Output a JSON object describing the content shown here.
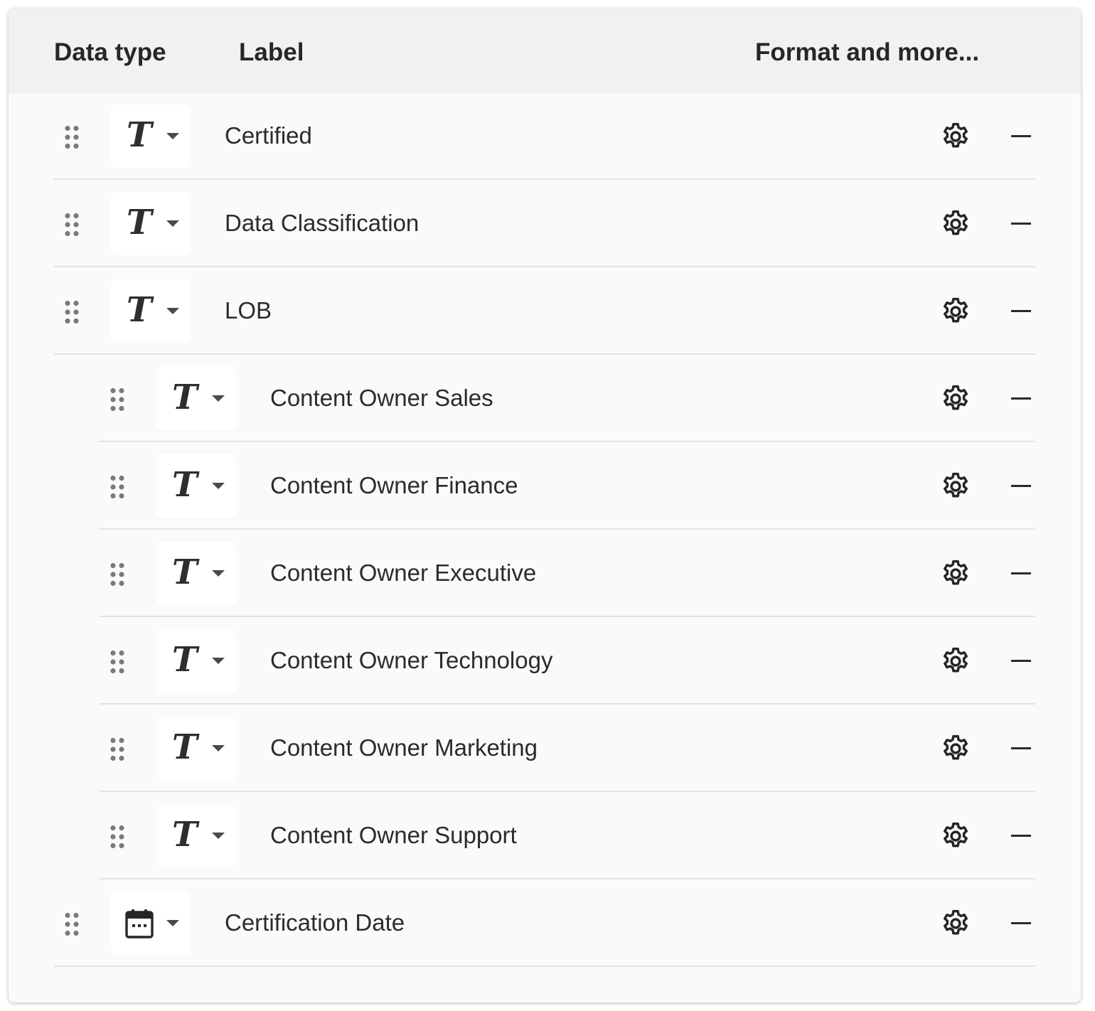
{
  "header": {
    "data_type": "Data type",
    "label": "Label",
    "format": "Format and more..."
  },
  "fields": [
    {
      "label": "Certified",
      "type": "text",
      "type_glyph": "T",
      "level": 0
    },
    {
      "label": "Data Classification",
      "type": "text",
      "type_glyph": "T",
      "level": 0
    },
    {
      "label": "LOB",
      "type": "text",
      "type_glyph": "T",
      "level": 0
    },
    {
      "label": "Content Owner Sales",
      "type": "text",
      "type_glyph": "T",
      "level": 1
    },
    {
      "label": "Content Owner Finance",
      "type": "text",
      "type_glyph": "T",
      "level": 1
    },
    {
      "label": "Content Owner Executive",
      "type": "text",
      "type_glyph": "T",
      "level": 1
    },
    {
      "label": "Content Owner Technology",
      "type": "text",
      "type_glyph": "T",
      "level": 1
    },
    {
      "label": "Content Owner Marketing",
      "type": "text",
      "type_glyph": "T",
      "level": 1
    },
    {
      "label": "Content Owner Support",
      "type": "text",
      "type_glyph": "T",
      "level": 1
    },
    {
      "label": "Certification Date",
      "type": "date",
      "level": 0
    }
  ],
  "icons": {
    "drag": "drag-handle-icon",
    "text_type": "text-type-icon",
    "date_type": "calendar-icon",
    "dropdown": "chevron-down-icon",
    "settings": "gear-icon",
    "remove": "minus-icon"
  },
  "colors": {
    "panel_bg": "#fafafa",
    "header_bg": "#f1f1f1",
    "text": "#2b2b2b",
    "divider": "#e2e2e2"
  }
}
